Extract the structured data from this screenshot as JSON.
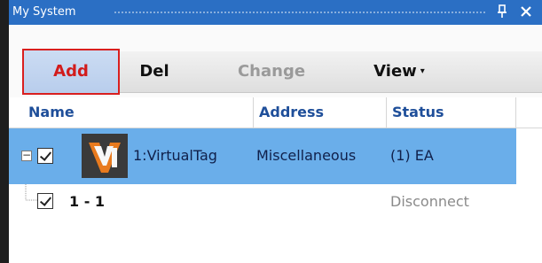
{
  "window": {
    "title": "My System",
    "pin_icon": "pin-icon",
    "close_icon": "close-icon"
  },
  "toolbar": {
    "add_label": "Add",
    "del_label": "Del",
    "change_label": "Change",
    "view_label": "View",
    "view_caret": "▾"
  },
  "columns": {
    "name": "Name",
    "address": "Address",
    "status": "Status"
  },
  "rows": [
    {
      "expander": "−",
      "checked": true,
      "icon": "virtualtag-logo-icon",
      "name": "1:VirtualTag",
      "address": "Miscellaneous",
      "status": "(1) EA",
      "selected": true
    },
    {
      "checked": true,
      "name": "1 - 1",
      "address": "",
      "status": "Disconnect",
      "selected": false
    }
  ],
  "colors": {
    "titlebar": "#2b6fc4",
    "selected_row": "#6aaeea",
    "header_text": "#1f4f9a",
    "add_text": "#d21b1b",
    "highlight_border": "#d91f1f",
    "disabled_text": "#9a9a9a"
  }
}
